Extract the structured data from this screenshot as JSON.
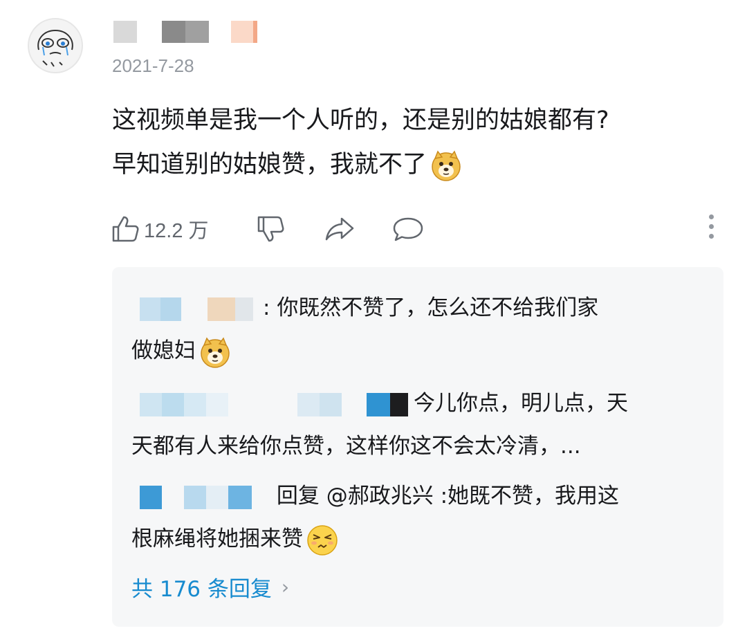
{
  "comment": {
    "timestamp": "2021-7-28",
    "text_lines": [
      "这视频单是我一个人听的，还是别的姑娘都有?",
      "早知道别的姑娘赞，我就不了"
    ],
    "emoji": "doge-emoji",
    "like_count": "12.2 万"
  },
  "actions": {
    "like_icon": "thumbs-up-icon",
    "dislike_icon": "thumbs-down-icon",
    "share_icon": "share-icon",
    "reply_icon": "comment-icon",
    "more_icon": "more-vertical-icon"
  },
  "replies": [
    {
      "separator": ":",
      "lines": [
        "你既然不赞了，怎么还不给我们家",
        "做媳妇"
      ],
      "emoji": "doge-emoji"
    },
    {
      "lines": [
        "今儿你点，明儿点，天",
        "天都有人来给你点赞，这样你这不会太冷清，..."
      ]
    },
    {
      "reply_prefix": "回复 @郝政兆兴 :",
      "lines": [
        "她既不赞，我用这",
        "根麻绳将她捆来赞"
      ],
      "emoji": "annoyed-emoji"
    }
  ],
  "footer": {
    "total_replies": "共 176 条回复",
    "chevron": "›"
  },
  "colors": {
    "link": "#178bcf",
    "muted": "#9499a0",
    "panel_bg": "#f6f7f8",
    "text": "#18191c"
  }
}
